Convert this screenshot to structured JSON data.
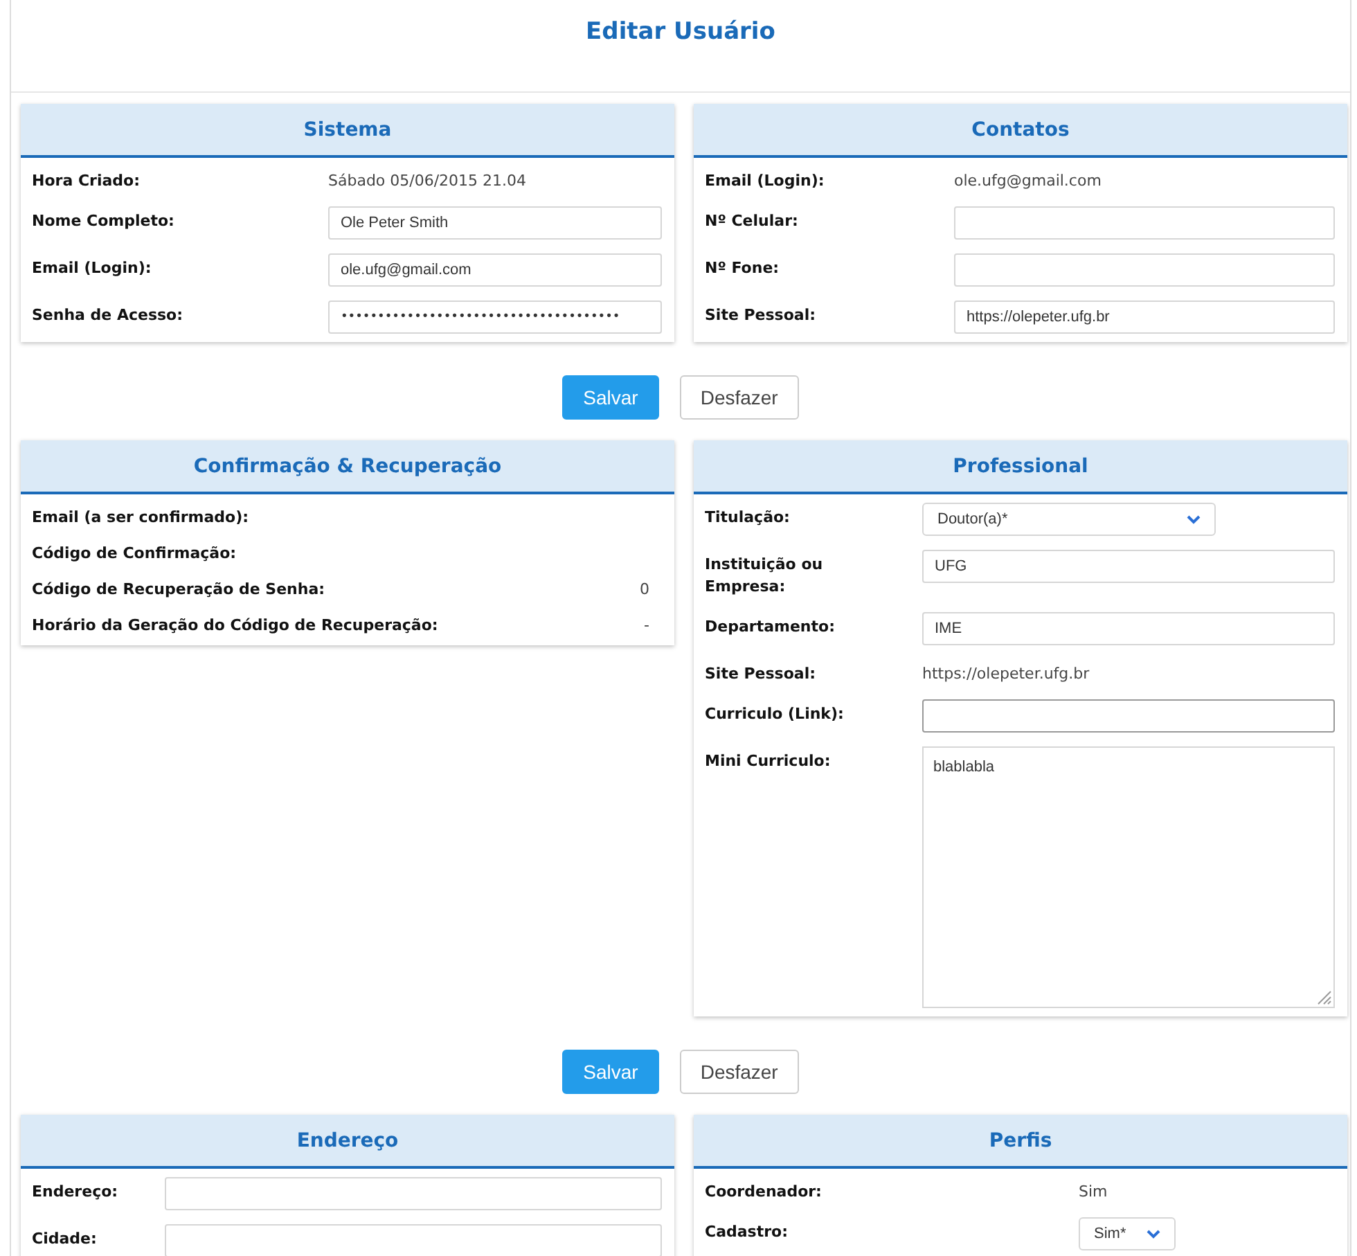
{
  "title": "Editar Usuário",
  "groups": [
    {
      "panels": [
        {
          "title": "Sistema",
          "fields": [
            {
              "kind": "text",
              "label": "Hora Criado:",
              "value": "Sábado 05/06/2015 21.04"
            },
            {
              "kind": "input",
              "label": "Nome Completo:",
              "value": "Ole Peter Smith"
            },
            {
              "kind": "input",
              "label": "Email (Login):",
              "value": "ole.ufg@gmail.com"
            },
            {
              "kind": "password",
              "label": "Senha de Acesso:",
              "value": "••••••••••••••••••••••••••••••••••••••"
            }
          ]
        },
        {
          "title": "Contatos",
          "fields": [
            {
              "kind": "text",
              "label": "Email (Login):",
              "value": "ole.ufg@gmail.com"
            },
            {
              "kind": "input",
              "label": "Nº Celular:"
            },
            {
              "kind": "input",
              "label": "Nº Fone:"
            },
            {
              "kind": "input",
              "label": "Site Pessoal:",
              "value": "https://olepeter.ufg.br"
            }
          ]
        }
      ],
      "buttons": [
        {
          "kind": "primary",
          "label": "Salvar"
        },
        {
          "kind": "secondary",
          "label": "Desfazer"
        }
      ]
    },
    {
      "panels": [
        {
          "title": "Confirmação & Recuperação",
          "fields": [
            {
              "kind": "number",
              "label": "Email (a ser confirmado):"
            },
            {
              "kind": "number",
              "label": "Código de Confirmação:"
            },
            {
              "kind": "number",
              "label": "Código de Recuperação de Senha:",
              "value": "0"
            },
            {
              "kind": "number",
              "label": "Horário da Geração do Código de Recuperação:",
              "value": "-"
            }
          ]
        },
        {
          "title": "Professional",
          "fields": [
            {
              "kind": "select",
              "label": "Titulação:",
              "value": "Doutor(a)*"
            },
            {
              "kind": "input",
              "label": "Instituição ou Empresa:",
              "value": "UFG"
            },
            {
              "kind": "input",
              "label": "Departamento:",
              "value": "IME"
            },
            {
              "kind": "text",
              "label": "Site Pessoal:",
              "value": "https://olepeter.ufg.br"
            },
            {
              "kind": "input",
              "label": "Curriculo (Link):",
              "focused": true
            },
            {
              "kind": "textarea",
              "label": "Mini Curriculo:",
              "value": "blablabla"
            }
          ]
        }
      ],
      "buttons": [
        {
          "kind": "primary",
          "label": "Salvar"
        },
        {
          "kind": "secondary",
          "label": "Desfazer"
        }
      ]
    },
    {
      "panels": [
        {
          "title": "Endereço",
          "fields": [
            {
              "kind": "input",
              "label": "Endereço:"
            },
            {
              "kind": "input",
              "label": "Cidade:"
            }
          ]
        },
        {
          "title": "Perfis",
          "fields": [
            {
              "kind": "text",
              "label": "Coordenador:",
              "value": "Sim"
            },
            {
              "kind": "select",
              "label": "Cadastro:",
              "value": "Sim*"
            }
          ]
        }
      ]
    }
  ]
}
